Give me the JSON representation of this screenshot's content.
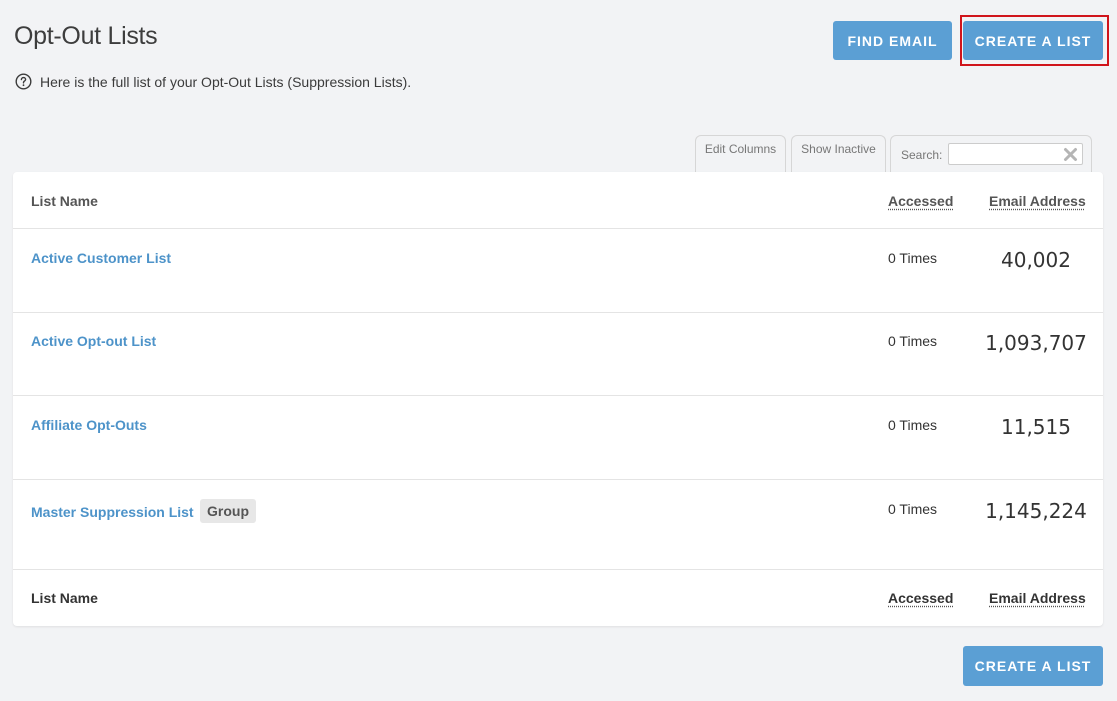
{
  "header": {
    "title": "Opt-Out Lists",
    "subtitle": "Here is the full list of your Opt-Out Lists (Suppression Lists).",
    "help_icon": "question-circle-icon"
  },
  "toolbar": {
    "find_email_label": "FIND EMAIL",
    "create_list_label": "CREATE A LIST",
    "highlight_color": "#d0141b",
    "button_color": "#5b9fd4"
  },
  "table_controls": {
    "edit_columns_label": "Edit Columns",
    "show_inactive_label": "Show Inactive",
    "search_label": "Search:",
    "search_value": "",
    "clear_icon": "clear-x-icon"
  },
  "table": {
    "columns": [
      "List Name",
      "Accessed",
      "Email Address"
    ],
    "rows": [
      {
        "name": "Active Customer List",
        "accessed": "0 Times",
        "email_count": "40,002",
        "badge": ""
      },
      {
        "name": "Active Opt-out List",
        "accessed": "0 Times",
        "email_count": "1,093,707",
        "badge": ""
      },
      {
        "name": "Affiliate Opt-Outs",
        "accessed": "0 Times",
        "email_count": "11,515",
        "badge": ""
      },
      {
        "name": "Master Suppression List",
        "accessed": "0 Times",
        "email_count": "1,145,224",
        "badge": "Group"
      }
    ],
    "footer_columns": [
      "List Name",
      "Accessed",
      "Email Address"
    ]
  },
  "footer": {
    "create_list_label": "CREATE A LIST"
  }
}
